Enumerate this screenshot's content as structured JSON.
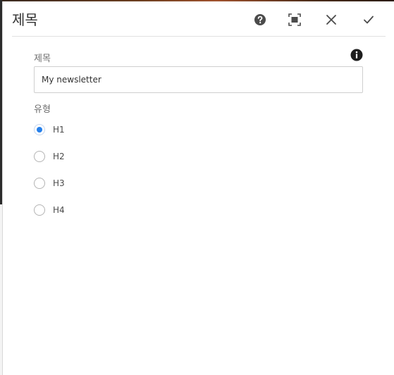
{
  "dialog": {
    "title": "제목",
    "actions": {
      "help_icon": "help-icon",
      "fullscreen_icon": "fullscreen-icon",
      "close_icon": "close-icon",
      "done_icon": "checkmark-icon"
    }
  },
  "fields": {
    "title_field": {
      "label": "제목",
      "value": "My newsletter",
      "info_icon": "info-icon"
    },
    "type_field": {
      "label": "유형",
      "options": [
        {
          "label": "H1",
          "checked": true
        },
        {
          "label": "H2",
          "checked": false
        },
        {
          "label": "H3",
          "checked": false
        },
        {
          "label": "H4",
          "checked": false
        }
      ]
    }
  },
  "colors": {
    "accent": "#2680eb",
    "text": "#323232",
    "label": "#6e6e6e",
    "border": "#cfcfcf"
  }
}
